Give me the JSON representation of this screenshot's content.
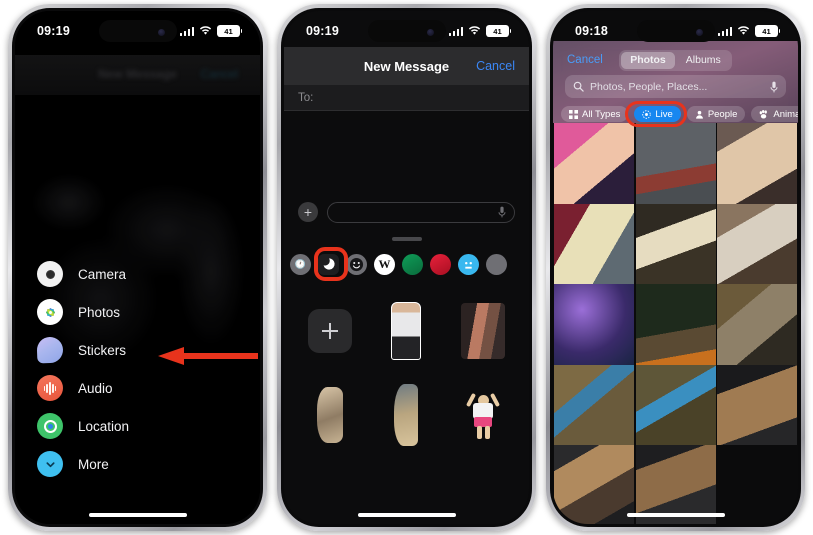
{
  "phones": [
    {
      "id": "phone-messages-apps-menu",
      "status": {
        "time": "09:19",
        "battery": "41"
      },
      "ghost_header": {
        "title": "New Message",
        "cancel": "Cancel"
      },
      "menu": {
        "items": [
          {
            "label": "Camera",
            "icon": "camera-icon"
          },
          {
            "label": "Photos",
            "icon": "photos-icon"
          },
          {
            "label": "Stickers",
            "icon": "stickers-icon"
          },
          {
            "label": "Audio",
            "icon": "audio-icon"
          },
          {
            "label": "Location",
            "icon": "location-icon"
          },
          {
            "label": "More",
            "icon": "chevron-down-icon"
          }
        ]
      },
      "annotation": {
        "type": "arrow-left",
        "color": "#e8331c",
        "points_at": "Stickers"
      }
    },
    {
      "id": "phone-new-message-stickers",
      "status": {
        "time": "09:19",
        "battery": "41"
      },
      "navbar": {
        "title": "New Message",
        "cancel": "Cancel"
      },
      "to_field": {
        "label": "To:",
        "value": ""
      },
      "input": {
        "placeholder": "",
        "plus_label": "+",
        "mic_icon": "microphone-icon"
      },
      "app_row": [
        {
          "name": "recents-clock-icon",
          "kind": "clock"
        },
        {
          "name": "stickers-app-icon",
          "kind": "sticker",
          "highlighted": true
        },
        {
          "name": "emoji-app-icon",
          "kind": "emoji"
        },
        {
          "name": "wikipedia-app-icon",
          "kind": "wiki",
          "label": "W"
        },
        {
          "name": "green-app-icon",
          "kind": "green"
        },
        {
          "name": "red-app-icon",
          "kind": "red"
        },
        {
          "name": "blue-app-icon",
          "kind": "blue"
        },
        {
          "name": "more-app-icon",
          "kind": "grey"
        }
      ],
      "sticker_grid": [
        [
          "add-sticker-button",
          "sticker-child-standing",
          "sticker-two-people"
        ],
        [
          "sticker-profile-left",
          "sticker-profile-center",
          "sticker-girl-jumping"
        ]
      ],
      "add_button_label": "+",
      "annotation": {
        "type": "arrow-up-left",
        "color": "#e8331c",
        "points_at": "add-sticker-button"
      }
    },
    {
      "id": "phone-photo-picker",
      "status": {
        "time": "09:18",
        "battery": "41"
      },
      "header": {
        "cancel": "Cancel",
        "segments": [
          {
            "label": "Photos",
            "selected": true
          },
          {
            "label": "Albums",
            "selected": false
          }
        ],
        "search": {
          "placeholder": "Photos, People, Places...",
          "icon": "search-icon",
          "mic_icon": "microphone-icon"
        },
        "filters": [
          {
            "label": "All Types",
            "icon": "grid-icon",
            "selected": false
          },
          {
            "label": "Live",
            "icon": "live-photo-icon",
            "selected": true
          },
          {
            "label": "People",
            "icon": "person-icon",
            "selected": false
          },
          {
            "label": "Animals",
            "icon": "paw-icon",
            "selected": false
          }
        ]
      },
      "annotation": {
        "type": "oval-highlight",
        "color": "#e8331c",
        "points_at": "Live"
      },
      "photo_grid": [
        [
          "baby-with-adults-pink",
          "boat-on-water",
          "couple-smiling"
        ],
        [
          "woman-and-baby-window",
          "baby-in-swing",
          "toddler-arms-up"
        ],
        [
          "purple-coral-reef",
          "child-by-firepit",
          "woman-at-fence"
        ],
        [
          "woman-at-fence-wide",
          "woman-at-fence-2",
          "puppy-on-blanket"
        ],
        [
          "puppies-on-blanket",
          "puppy-closeup",
          ""
        ]
      ]
    }
  ],
  "colors": {
    "annotation_red": "#e8331c",
    "ios_blue": "#3b87f5",
    "live_chip_blue": "#1787f0"
  }
}
